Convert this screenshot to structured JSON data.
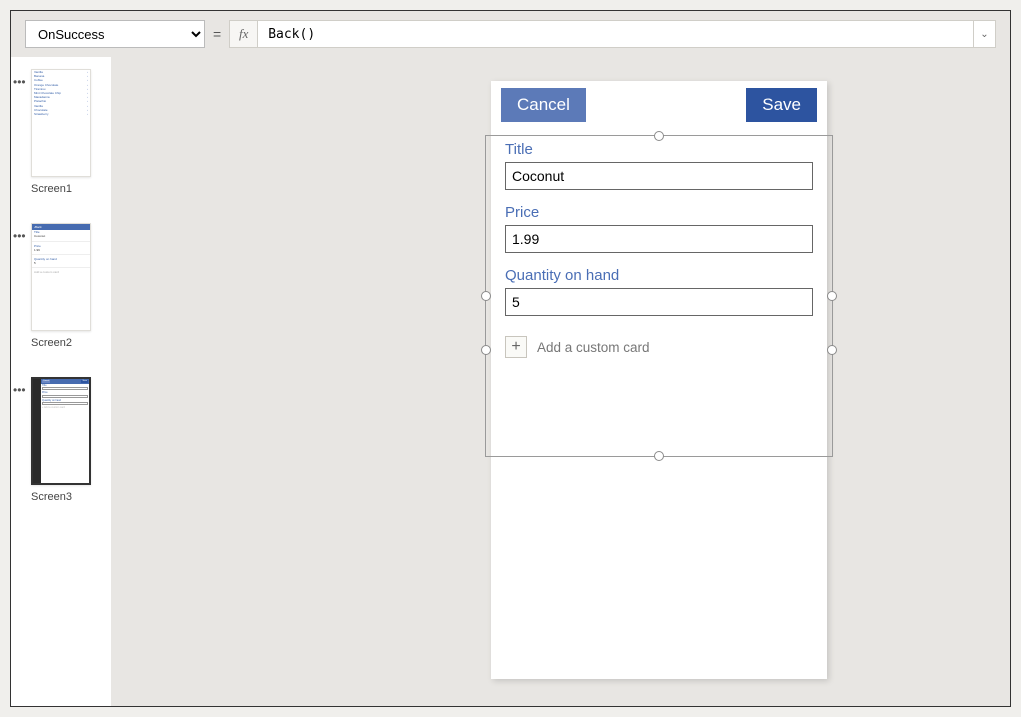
{
  "formulaBar": {
    "property": "OnSuccess",
    "equals": "=",
    "fx": "fx",
    "formula": "Back()"
  },
  "thumbnails": {
    "screen1": {
      "label": "Screen1",
      "items": [
        "Vanilla",
        "Banana",
        "Coffee",
        "Orange Chocolate",
        "Tiramisu",
        "Mint Chocolate Chip",
        "Macadamia",
        "Pistachio",
        "Vanilla",
        "Chocolate",
        "Strawberry"
      ]
    },
    "screen2": {
      "label": "Screen2",
      "back": "Back",
      "lines": [
        "Title",
        "Coconut",
        "Price",
        "1.99",
        "Quantity on hand",
        "5"
      ],
      "note": "Add a custom card"
    },
    "screen3": {
      "label": "Screen3",
      "cancel": "Cancel",
      "save": "Save",
      "labels": [
        "Title",
        "Price",
        "Quantity on hand"
      ]
    }
  },
  "phone": {
    "cancel": "Cancel",
    "save": "Save",
    "titleLabel": "Title",
    "titleValue": "Coconut",
    "priceLabel": "Price",
    "priceValue": "1.99",
    "qtyLabel": "Quantity on hand",
    "qtyValue": "5",
    "addCustom": "Add a custom card"
  }
}
